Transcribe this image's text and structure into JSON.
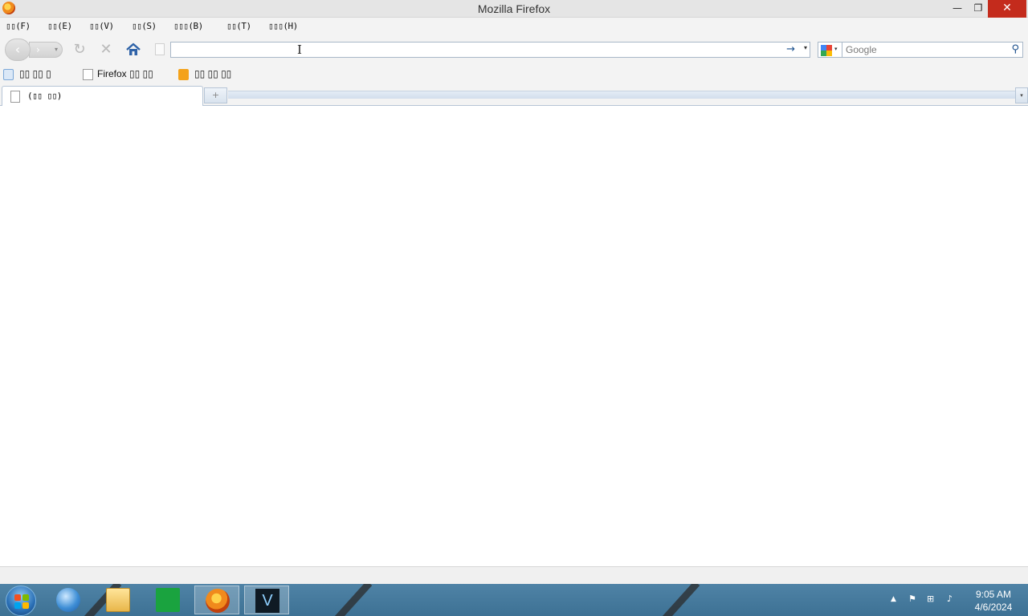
{
  "window": {
    "title": "Mozilla Firefox",
    "minimize_glyph": "—",
    "restore_glyph": "❐",
    "close_glyph": "✕"
  },
  "menu": {
    "items": [
      {
        "label": "▯▯(F)"
      },
      {
        "label": "▯▯(E)"
      },
      {
        "label": "▯▯(V)"
      },
      {
        "label": "▯▯(S)"
      },
      {
        "label": "▯▯▯(B)"
      },
      {
        "label": "▯▯(T)"
      },
      {
        "label": "▯▯▯(H)"
      }
    ]
  },
  "navigation": {
    "back_glyph": "‹",
    "forward_glyph": "›",
    "reload_glyph": "↻",
    "stop_glyph": "✕",
    "url_value": "",
    "go_glyph": "→",
    "dropdown_glyph": "▾",
    "cursor_glyph": "I"
  },
  "search": {
    "engine_icon": "google-icon",
    "placeholder": "Google",
    "value": "",
    "go_glyph": "⚲"
  },
  "bookmarks": {
    "items": [
      {
        "label": "▯▯ ▯▯ ▯",
        "icon": "search-icon"
      },
      {
        "label": "Firefox ▯▯ ▯▯",
        "icon": "page-icon"
      },
      {
        "label": "▯▯ ▯▯ ▯▯",
        "icon": "rss-icon"
      }
    ]
  },
  "tabs": {
    "items": [
      {
        "label": "(▯▯ ▯▯)"
      }
    ],
    "new_tab_glyph": "+",
    "list_glyph": "▾"
  },
  "taskbar": {
    "apps": [
      "start-icon",
      "internet-explorer-icon",
      "file-explorer-icon",
      "store-icon",
      "firefox-icon",
      "v-app-icon"
    ],
    "v_app_label": "V",
    "tray_expand_glyph": "▲",
    "tray_flag_glyph": "⚑",
    "tray_network_glyph": "⊞",
    "tray_volume_glyph": "♪",
    "time": "9:05 AM",
    "date": "4/6/2024"
  },
  "colors": {
    "taskbar": "#4f83a6",
    "close_button": "#c42b1c",
    "url_border": "#a9b8c8"
  }
}
